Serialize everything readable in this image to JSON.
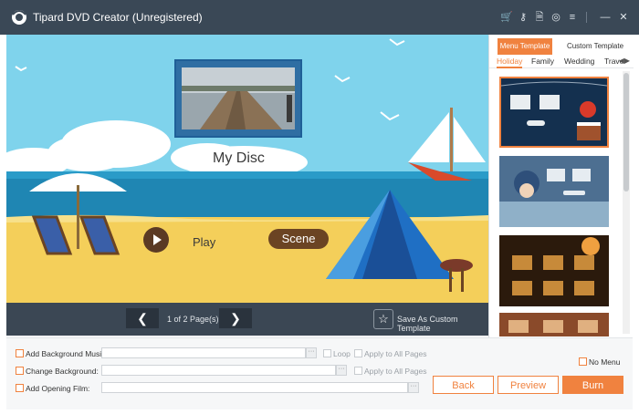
{
  "app": {
    "title": "Tipard DVD Creator (Unregistered)"
  },
  "titlebar_icons": [
    "cart-icon",
    "key-icon",
    "document-icon",
    "chat-icon",
    "menu-icon",
    "minimize-icon",
    "close-icon"
  ],
  "preview": {
    "disc_title": "My Disc",
    "play_label": "Play",
    "scene_label": "Scene"
  },
  "pager": {
    "page_text": "1 of 2 Page(s)",
    "save_template": "Save As Custom Template"
  },
  "panel": {
    "tabs": [
      "Menu Template",
      "Custom Template"
    ],
    "categories": [
      "Holiday",
      "Family",
      "Wedding",
      "Trave"
    ],
    "active_category": "Holiday"
  },
  "bottom": {
    "add_music": "Add Background Music:",
    "change_bg": "Change Background:",
    "add_film": "Add Opening Film:",
    "loop": "Loop",
    "apply_all_1": "Apply to All Pages",
    "apply_all_2": "Apply to All Pages",
    "no_menu": "No Menu",
    "dots": "···",
    "back": "Back",
    "preview": "Preview",
    "burn": "Burn"
  },
  "colors": {
    "accent": "#f0823f",
    "titlebar": "#3a4856",
    "pager": "#3b4754"
  }
}
